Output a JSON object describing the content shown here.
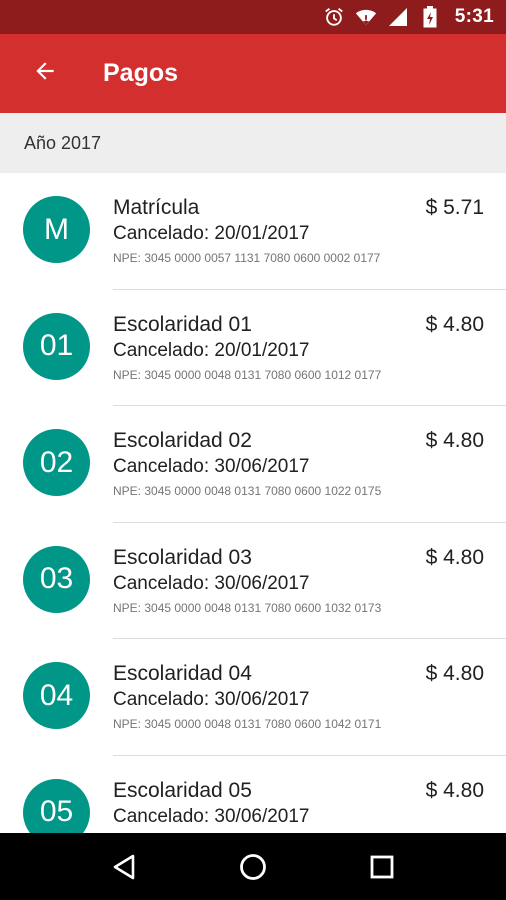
{
  "status_bar": {
    "time": "5:31",
    "icons": [
      "alarm-icon",
      "wifi-icon",
      "signal-icon",
      "battery-icon"
    ]
  },
  "app_bar": {
    "title": "Pagos",
    "back_icon": "arrow-back-icon"
  },
  "section": {
    "header": "Año 2017"
  },
  "payments": [
    {
      "avatar": "M",
      "title": "Matrícula",
      "amount": "$ 5.71",
      "date": "Cancelado: 20/01/2017",
      "npe": "NPE: 3045 0000 0057 1131 7080 0600 0002 0177"
    },
    {
      "avatar": "01",
      "title": "Escolaridad 01",
      "amount": "$ 4.80",
      "date": "Cancelado: 20/01/2017",
      "npe": "NPE: 3045 0000 0048 0131 7080 0600 1012 0177"
    },
    {
      "avatar": "02",
      "title": "Escolaridad 02",
      "amount": "$ 4.80",
      "date": "Cancelado: 30/06/2017",
      "npe": "NPE: 3045 0000 0048 0131 7080 0600 1022 0175"
    },
    {
      "avatar": "03",
      "title": "Escolaridad 03",
      "amount": "$ 4.80",
      "date": "Cancelado: 30/06/2017",
      "npe": "NPE: 3045 0000 0048 0131 7080 0600 1032 0173"
    },
    {
      "avatar": "04",
      "title": "Escolaridad 04",
      "amount": "$ 4.80",
      "date": "Cancelado: 30/06/2017",
      "npe": "NPE: 3045 0000 0048 0131 7080 0600 1042 0171"
    },
    {
      "avatar": "05",
      "title": "Escolaridad 05",
      "amount": "$ 4.80",
      "date": "Cancelado: 30/06/2017",
      "npe": ""
    }
  ],
  "nav_bar": {
    "icons": [
      "back-triangle-icon",
      "home-circle-icon",
      "recents-square-icon"
    ]
  },
  "colors": {
    "status_bar": "#8f1c1c",
    "app_bar": "#d32f2f",
    "avatar": "#009688",
    "section_bg": "#eeeeee"
  }
}
